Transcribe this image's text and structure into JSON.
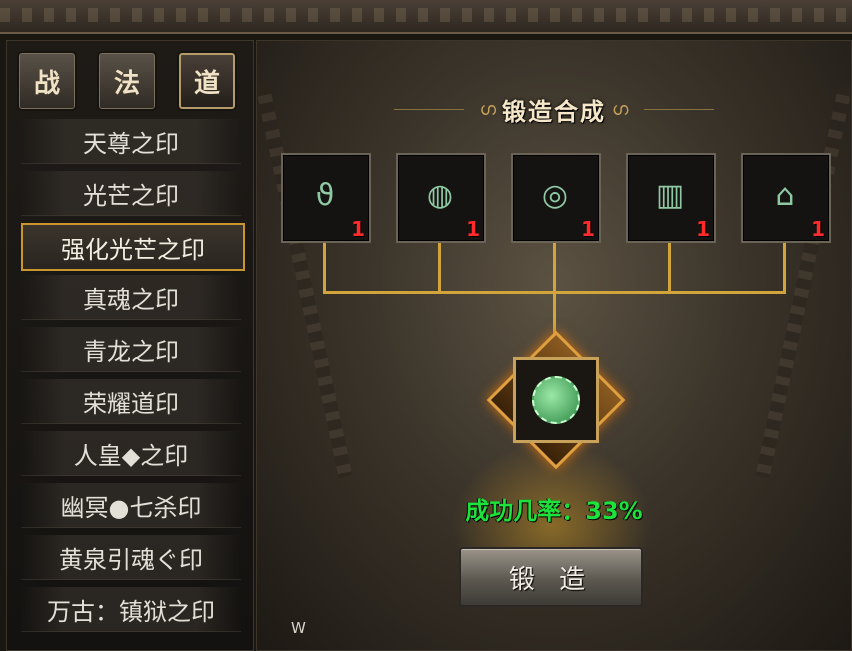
{
  "tabs": [
    {
      "label": "战",
      "active": false
    },
    {
      "label": "法",
      "active": false
    },
    {
      "label": "道",
      "active": true
    }
  ],
  "menu": [
    {
      "label": "天尊之印",
      "selected": false
    },
    {
      "label": "光芒之印",
      "selected": false
    },
    {
      "label": "强化光芒之印",
      "selected": true
    },
    {
      "label": "真魂之印",
      "selected": false
    },
    {
      "label": "青龙之印",
      "selected": false
    },
    {
      "label": "荣耀道印",
      "selected": false
    },
    {
      "label": "人皇◆之印",
      "selected": false
    },
    {
      "label": "幽冥●七杀印",
      "selected": false
    },
    {
      "label": "黄泉引魂ぐ印",
      "selected": false
    },
    {
      "label": "万古：镇狱之印",
      "selected": false
    }
  ],
  "panel": {
    "title": "锻造合成",
    "title_ornament": "ഗ",
    "materials": [
      {
        "icon": "necklace-icon",
        "qty": "1"
      },
      {
        "icon": "bracelet-icon",
        "qty": "1"
      },
      {
        "icon": "ring-icon",
        "qty": "1"
      },
      {
        "icon": "belt-icon",
        "qty": "1"
      },
      {
        "icon": "boots-icon",
        "qty": "1"
      }
    ],
    "result_icon": "jade-seal-icon",
    "success_rate": "成功几率：33%",
    "forge_button": "锻 造",
    "hint": "W"
  },
  "colors": {
    "rate_green": "#1ee23c",
    "qty_red": "#ff2a2a",
    "selected_border": "#c9952c",
    "connector_gold": "#d1a43c"
  }
}
